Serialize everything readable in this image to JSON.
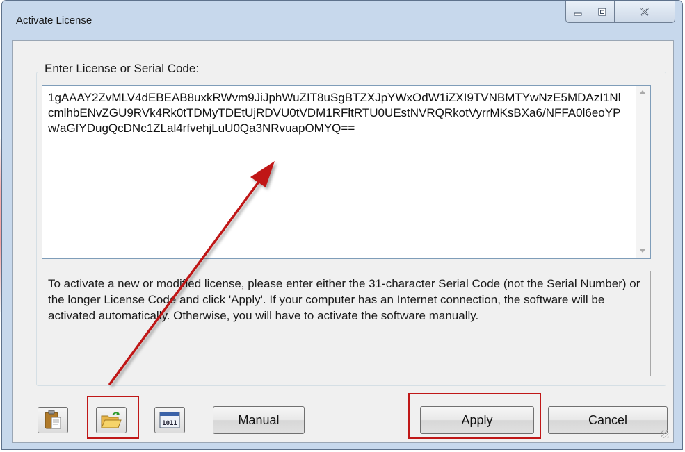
{
  "window": {
    "title": "Activate License",
    "controls": {
      "minimize": "minimize-icon",
      "maximize": "maximize-icon",
      "close": "close-icon"
    }
  },
  "form": {
    "group_label": "Enter License or Serial Code:",
    "license_code": "1gAAAY2ZvMLV4dEBEAB8uxkRWvm9JiJphWuZIT8uSgBTZXJpYWxOdW1iZXI9TVNBMTYwNzE5MDAzI1NlcmlhbENvZGU9RVk4Rk0tTDMyTDEtUjRDVU0tVDM1RFltRTU0UEstNVRQRkotVyrrMKsBXa6/NFFA0l6eoYPw/aGfYDugQcDNc1ZLal4rfvehjLuU0Qa3NRvuapOMYQ==",
    "instructions": "To activate a new or modified license, please enter either the 31-character Serial Code (not the Serial Number) or the longer License Code and click 'Apply'.  If your computer has an Internet connection, the software will be activated automatically.  Otherwise, you will have to activate the software manually."
  },
  "buttons": {
    "paste_icon": "clipboard-paste-icon",
    "open_icon": "folder-open-icon",
    "binary_icon": "binary-1011-icon",
    "binary_glyph": "1011",
    "manual": "Manual",
    "apply": "Apply",
    "cancel": "Cancel"
  },
  "colors": {
    "highlight": "#c01818",
    "arrow": "#c01818",
    "window_frame": "#c7d8ec"
  }
}
